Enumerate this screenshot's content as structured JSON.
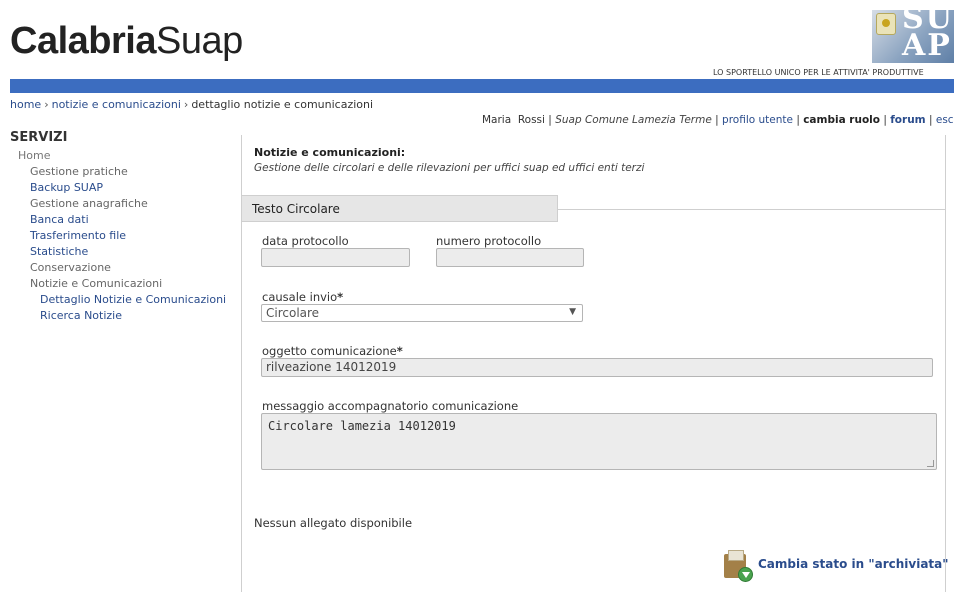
{
  "header": {
    "logo_bold": "Calabria",
    "logo_light": "Suap",
    "badge_letters": "SU\nAP",
    "tagline": "LO SPORTELLO UNICO PER LE ATTIVITA' PRODUTTIVE"
  },
  "breadcrumb": {
    "items": [
      "home",
      "notizie e comunicazioni",
      "dettaglio notizie e comunicazioni"
    ],
    "separator": "›"
  },
  "userbar": {
    "user_name": "Maria  Rossi",
    "office": "Suap Comune Lamezia Terme",
    "profile": "profilo utente",
    "change_role": "cambia ruolo",
    "forum": "forum",
    "logout": "esci",
    "divider": "|"
  },
  "sidebar": {
    "title": "SERVIZI",
    "items": [
      {
        "label": "Home"
      },
      {
        "label": "Gestione pratiche"
      },
      {
        "label": "Backup SUAP"
      },
      {
        "label": "Gestione anagrafiche"
      },
      {
        "label": "Banca dati"
      },
      {
        "label": "Trasferimento file"
      },
      {
        "label": "Statistiche"
      },
      {
        "label": "Conservazione"
      },
      {
        "label": "Notizie e Comunicazioni"
      },
      {
        "label": "Dettaglio Notizie e Comunicazioni"
      },
      {
        "label": "Ricerca Notizie"
      }
    ]
  },
  "main": {
    "title": "Notizie e comunicazioni:",
    "subtitle": "Gestione delle circolari e delle rilevazioni per uffici suap ed uffici enti terzi",
    "tab": "Testo Circolare",
    "fields": {
      "data_protocollo": {
        "label": "data protocollo",
        "value": ""
      },
      "numero_protocollo": {
        "label": "numero protocollo",
        "value": ""
      },
      "causale_invio": {
        "label": "causale invio",
        "required_mark": "*",
        "value": "Circolare",
        "arrow": "▼"
      },
      "oggetto": {
        "label": "oggetto comunicazione",
        "required_mark": "*",
        "value": "rilveazione 14012019"
      },
      "messaggio": {
        "label": "messaggio accompagnatorio comunicazione",
        "value": "Circolare lamezia 14012019"
      }
    },
    "no_attachments": "Nessun allegato disponibile",
    "action_label": "Cambia stato in \"archiviata\"",
    "action_icon": "archive-download-icon"
  },
  "colors": {
    "band": "#3c6dc0",
    "link": "#2a4c8c",
    "input_bg": "#ececec"
  }
}
